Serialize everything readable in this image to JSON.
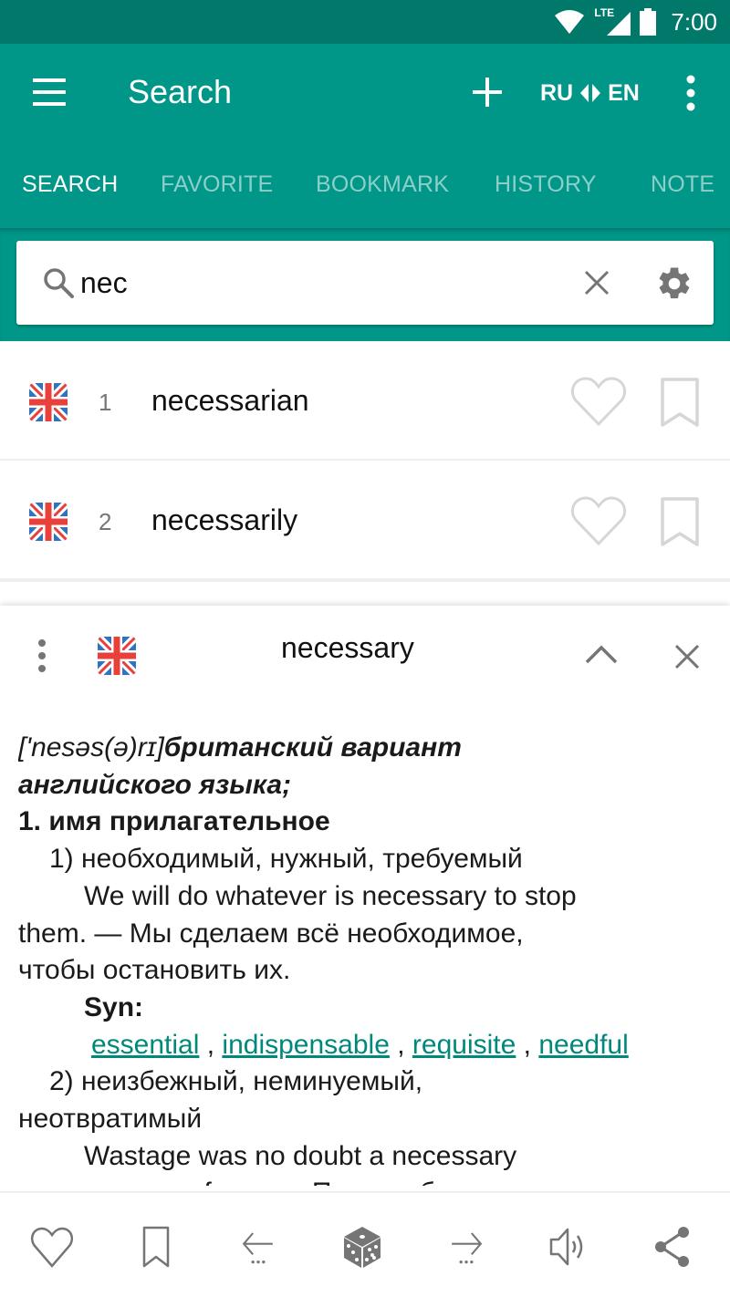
{
  "status_bar": {
    "network": "LTE",
    "time": "7:00",
    "icons": [
      "wifi-icon",
      "cellular-signal-icon",
      "battery-icon"
    ]
  },
  "app_bar": {
    "title": "Search",
    "lang_from": "RU",
    "lang_to": "EN",
    "icons": [
      "menu-icon",
      "plus-icon",
      "swap-arrows-icon",
      "more-vertical-icon"
    ]
  },
  "tabs": [
    {
      "label": "SEARCH",
      "active": true
    },
    {
      "label": "FAVORITE",
      "active": false
    },
    {
      "label": "BOOKMARK",
      "active": false
    },
    {
      "label": "HISTORY",
      "active": false
    },
    {
      "label": "NOTE",
      "active": false
    }
  ],
  "search": {
    "value": "nec",
    "icons": [
      "search-icon",
      "clear-icon",
      "gear-icon"
    ]
  },
  "results": [
    {
      "index": "1",
      "word": "necessarian",
      "flag": "uk-flag-icon"
    },
    {
      "index": "2",
      "word": "necessarily",
      "flag": "uk-flag-icon"
    }
  ],
  "entry": {
    "headword": "necessary",
    "transcription": "['nesəs(ə)rɪ]",
    "variant_note_1": "британский вариант",
    "variant_note_2": "английского языка;",
    "pos": "1. имя прилагательное",
    "sense1": "1) необходимый, нужный, требуемый",
    "example1_en_a": "We will do whatever is necessary to stop",
    "example1_en_b": "them. — Мы сделаем всё необходимое,",
    "example1_ru": "чтобы остановить их.",
    "syn_label": "Syn:",
    "synonyms": [
      "essential",
      "indispensable",
      "requisite",
      "needful"
    ],
    "sep": " , ",
    "sense2_a": "2) неизбежный, неминуемый,",
    "sense2_b": "неотвратимый",
    "example2_a": "Wastage was no doubt a necessary",
    "example2_b": "consequence of war. — Потери, безусловно"
  },
  "bottom_toolbar": [
    "heart-icon",
    "bookmark-icon",
    "previous-arrow-icon",
    "dice-random-icon",
    "next-arrow-icon",
    "speaker-icon",
    "share-icon"
  ],
  "colors": {
    "primary": "#009688",
    "primary_dark": "#00796B",
    "link": "#00897B",
    "icon_gray": "#757575",
    "icon_light": "#d6d6d6"
  }
}
